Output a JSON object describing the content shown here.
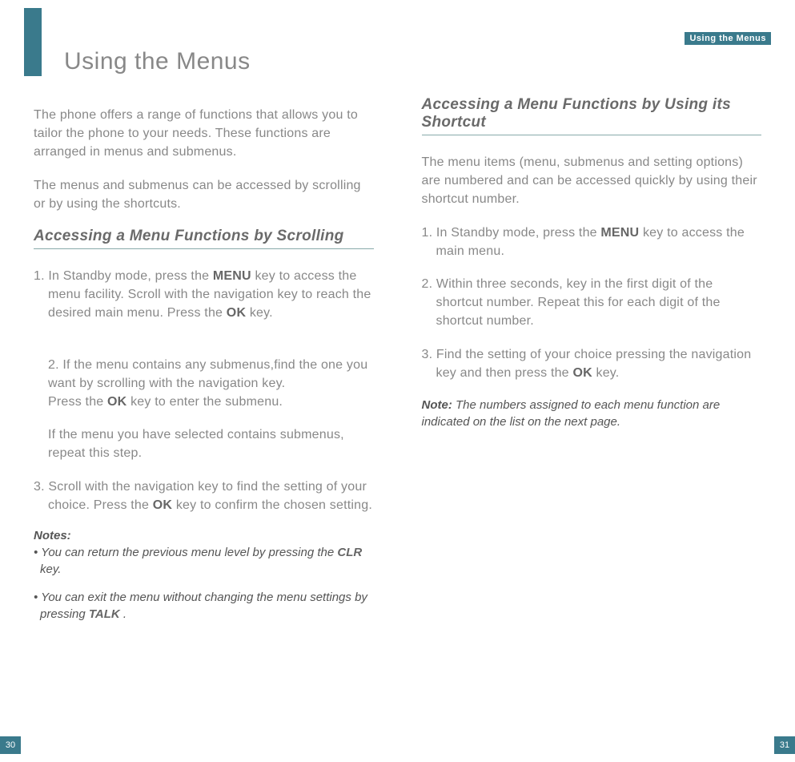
{
  "header": {
    "label": "Using the Menus"
  },
  "left": {
    "title": "Using the Menus",
    "intro1": "The phone offers a range of functions that allows you to tailor the phone to your needs. These functions are arranged in menus and submenus.",
    "intro2": "The menus and submenus can be accessed by scrolling or by using the shortcuts.",
    "section": "Accessing a Menu Functions by Scrolling",
    "step1a": "1.  In Standby mode, press the ",
    "step1key": "MENU",
    "step1b": " key to access the menu facility. Scroll with the navigation key to reach the desired main menu. Press the ",
    "step1key2": "OK",
    "step1c": " key.",
    "step2a": "2.  If the menu contains any submenus,find the one you want by scrolling with the navigation key.\nPress the ",
    "step2key": "OK",
    "step2b": " key to enter the submenu.",
    "step2sub": "If the menu you have selected contains submenus, repeat this step.",
    "step3a": "3.  Scroll with the navigation key to find the setting of your choice. Press the ",
    "step3key": "OK",
    "step3b": " key to confirm the chosen setting.",
    "notes_label": "Notes:",
    "note1a": "• You can return the previous menu level by pressing the ",
    "note1key": "CLR",
    "note1b": " key.",
    "note2a": "• You can exit the menu without changing the menu settings by pressing ",
    "note2key": "TALK",
    "note2b": " .",
    "page_num": "30"
  },
  "right": {
    "section": "Accessing a Menu Functions by Using its Shortcut",
    "intro": "The menu items (menu, submenus and setting options) are numbered and can be accessed quickly by using their shortcut number.",
    "step1a": "1. In Standby mode, press the ",
    "step1key": "MENU",
    "step1b": " key to access the main menu.",
    "step2": "2.  Within three seconds, key in the first digit of the shortcut number. Repeat this for each digit of the shortcut number.",
    "step3a": "3. Find the setting of your choice pressing the navigation key and then press the ",
    "step3key": "OK",
    "step3b": " key.",
    "note_lead": "Note:",
    "note_body": " The numbers assigned to each menu function are indicated on the list on the next page.",
    "page_num": "31"
  }
}
